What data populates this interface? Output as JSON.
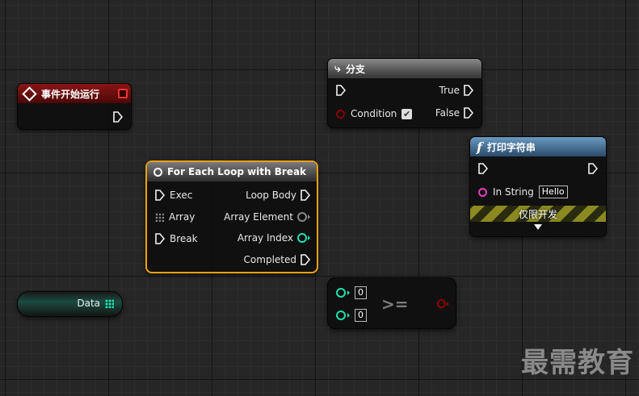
{
  "event_node": {
    "title": "事件开始运行"
  },
  "branch_node": {
    "title": "分支",
    "condition": "Condition",
    "true_label": "True",
    "false_label": "False"
  },
  "print_node": {
    "title": "打印字符串",
    "in_string_label": "In String",
    "in_string_value": "Hello",
    "dev_only": "仅限开发",
    "func_glyph": "f"
  },
  "foreach_node": {
    "title": "For Each Loop with Break",
    "inputs": [
      "Exec",
      "Array",
      "Break"
    ],
    "outputs": [
      "Loop Body",
      "Array Element",
      "Array Index",
      "Completed"
    ]
  },
  "data_node": {
    "label": "Data"
  },
  "compare_node": {
    "a": "0",
    "b": "0",
    "operator": ">="
  },
  "watermark": "最需教育",
  "colors": {
    "event_header": "#7a1010",
    "branch_header": "#505050",
    "print_header": "#3a6a94",
    "selection_outline": "#f0a010",
    "int_pin": "#1fe0b0",
    "bool_pin": "#8a0000",
    "string_pin": "#e040c0",
    "wildcard_pin": "#888888"
  }
}
